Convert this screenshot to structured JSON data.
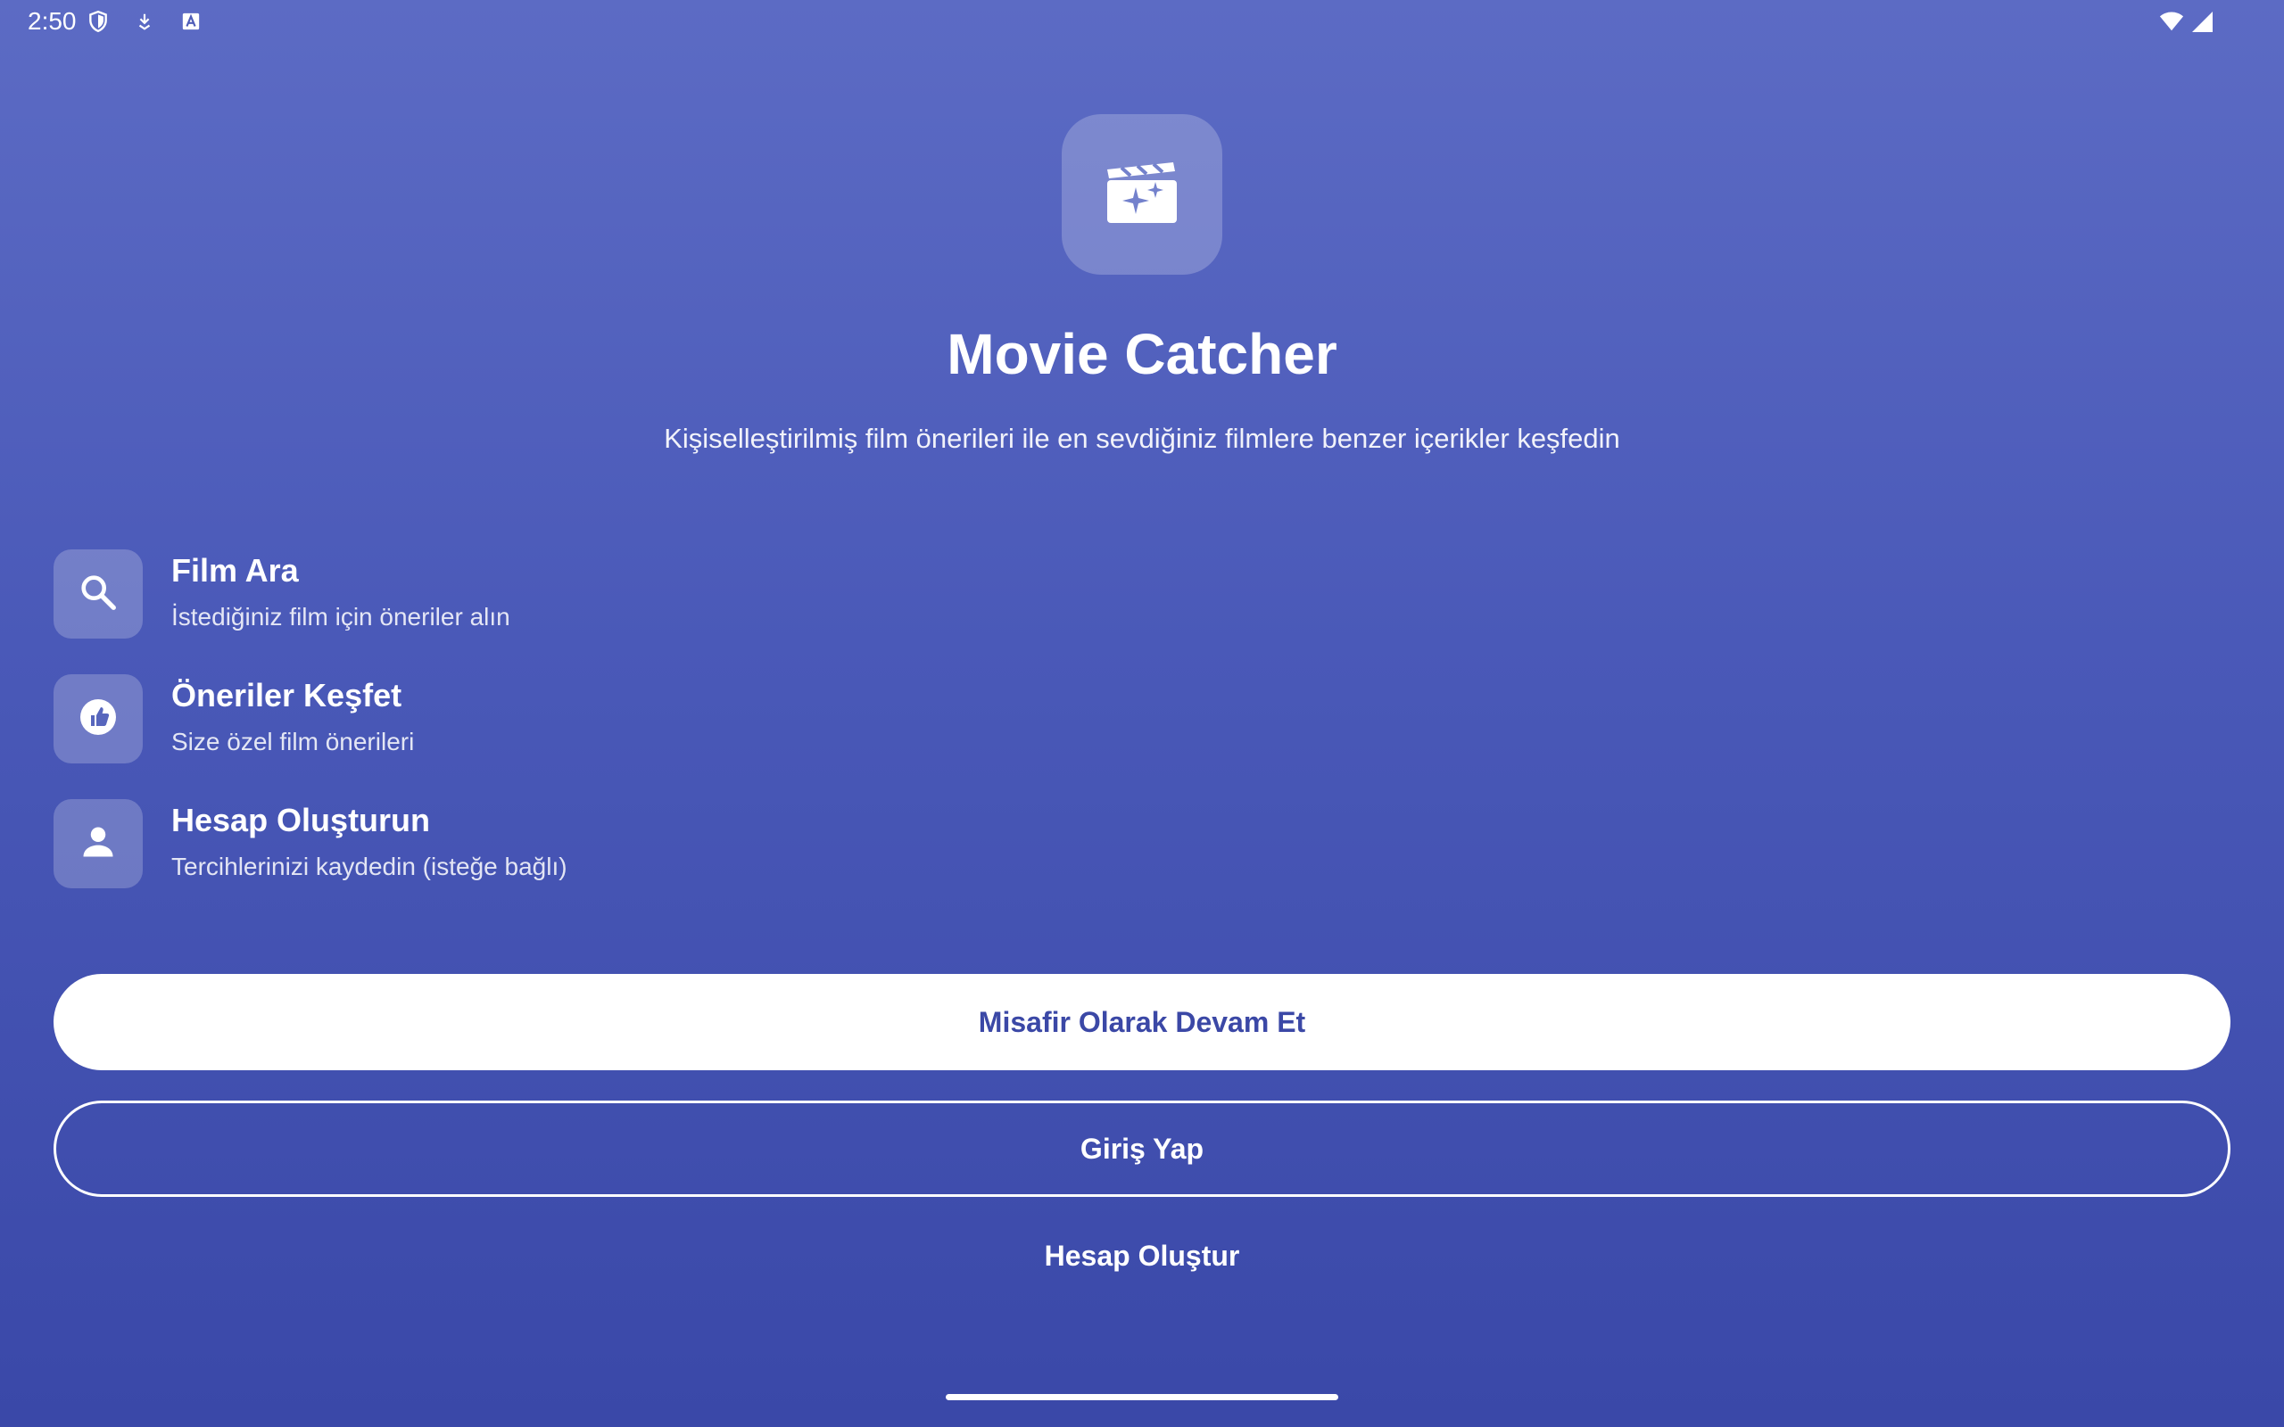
{
  "status_bar": {
    "time": "2:50",
    "left_icons": [
      "shield-icon",
      "download-icon",
      "a-box-icon"
    ],
    "right_icons": [
      "wifi-icon",
      "signal-icon"
    ]
  },
  "app": {
    "logo_icon": "movie-clapper-sparkle-icon",
    "title": "Movie Catcher",
    "subtitle": "Kişiselleştirilmiş film önerileri ile en sevdiğiniz filmlere benzer içerikler keşfedin"
  },
  "features": [
    {
      "icon": "search-icon",
      "title": "Film Ara",
      "desc": "İstediğiniz film için öneriler alın"
    },
    {
      "icon": "recommend-icon",
      "title": "Öneriler Keşfet",
      "desc": "Size özel film önerileri"
    },
    {
      "icon": "person-icon",
      "title": "Hesap Oluşturun",
      "desc": "Tercihlerinizi kaydedin (isteğe bağlı)"
    }
  ],
  "buttons": {
    "guest": "Misafir Olarak Devam Et",
    "login": "Giriş Yap",
    "register": "Hesap Oluştur"
  },
  "colors": {
    "gradient_top": "#5c6bc4",
    "gradient_bottom": "#3a48a8",
    "primary_button_text": "#3b48a6"
  }
}
